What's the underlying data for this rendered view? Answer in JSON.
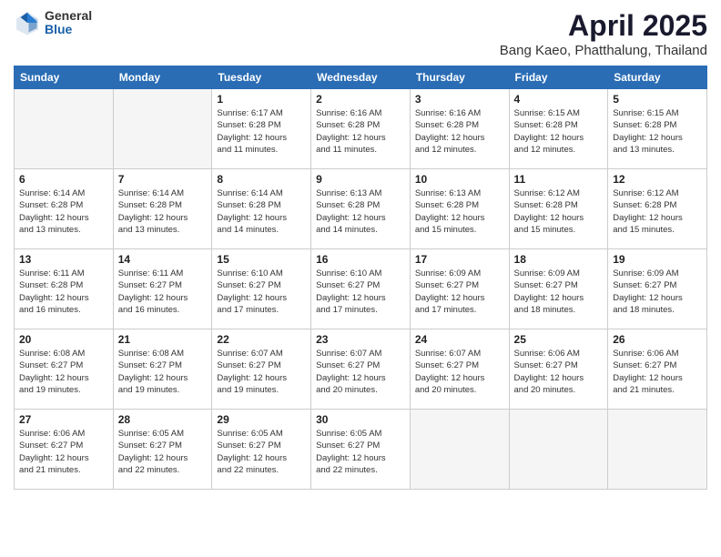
{
  "logo": {
    "general": "General",
    "blue": "Blue"
  },
  "title": "April 2025",
  "subtitle": "Bang Kaeo, Phatthalung, Thailand",
  "headers": [
    "Sunday",
    "Monday",
    "Tuesday",
    "Wednesday",
    "Thursday",
    "Friday",
    "Saturday"
  ],
  "weeks": [
    [
      {
        "day": "",
        "info": ""
      },
      {
        "day": "",
        "info": ""
      },
      {
        "day": "1",
        "info": "Sunrise: 6:17 AM\nSunset: 6:28 PM\nDaylight: 12 hours\nand 11 minutes."
      },
      {
        "day": "2",
        "info": "Sunrise: 6:16 AM\nSunset: 6:28 PM\nDaylight: 12 hours\nand 11 minutes."
      },
      {
        "day": "3",
        "info": "Sunrise: 6:16 AM\nSunset: 6:28 PM\nDaylight: 12 hours\nand 12 minutes."
      },
      {
        "day": "4",
        "info": "Sunrise: 6:15 AM\nSunset: 6:28 PM\nDaylight: 12 hours\nand 12 minutes."
      },
      {
        "day": "5",
        "info": "Sunrise: 6:15 AM\nSunset: 6:28 PM\nDaylight: 12 hours\nand 13 minutes."
      }
    ],
    [
      {
        "day": "6",
        "info": "Sunrise: 6:14 AM\nSunset: 6:28 PM\nDaylight: 12 hours\nand 13 minutes."
      },
      {
        "day": "7",
        "info": "Sunrise: 6:14 AM\nSunset: 6:28 PM\nDaylight: 12 hours\nand 13 minutes."
      },
      {
        "day": "8",
        "info": "Sunrise: 6:14 AM\nSunset: 6:28 PM\nDaylight: 12 hours\nand 14 minutes."
      },
      {
        "day": "9",
        "info": "Sunrise: 6:13 AM\nSunset: 6:28 PM\nDaylight: 12 hours\nand 14 minutes."
      },
      {
        "day": "10",
        "info": "Sunrise: 6:13 AM\nSunset: 6:28 PM\nDaylight: 12 hours\nand 15 minutes."
      },
      {
        "day": "11",
        "info": "Sunrise: 6:12 AM\nSunset: 6:28 PM\nDaylight: 12 hours\nand 15 minutes."
      },
      {
        "day": "12",
        "info": "Sunrise: 6:12 AM\nSunset: 6:28 PM\nDaylight: 12 hours\nand 15 minutes."
      }
    ],
    [
      {
        "day": "13",
        "info": "Sunrise: 6:11 AM\nSunset: 6:28 PM\nDaylight: 12 hours\nand 16 minutes."
      },
      {
        "day": "14",
        "info": "Sunrise: 6:11 AM\nSunset: 6:27 PM\nDaylight: 12 hours\nand 16 minutes."
      },
      {
        "day": "15",
        "info": "Sunrise: 6:10 AM\nSunset: 6:27 PM\nDaylight: 12 hours\nand 17 minutes."
      },
      {
        "day": "16",
        "info": "Sunrise: 6:10 AM\nSunset: 6:27 PM\nDaylight: 12 hours\nand 17 minutes."
      },
      {
        "day": "17",
        "info": "Sunrise: 6:09 AM\nSunset: 6:27 PM\nDaylight: 12 hours\nand 17 minutes."
      },
      {
        "day": "18",
        "info": "Sunrise: 6:09 AM\nSunset: 6:27 PM\nDaylight: 12 hours\nand 18 minutes."
      },
      {
        "day": "19",
        "info": "Sunrise: 6:09 AM\nSunset: 6:27 PM\nDaylight: 12 hours\nand 18 minutes."
      }
    ],
    [
      {
        "day": "20",
        "info": "Sunrise: 6:08 AM\nSunset: 6:27 PM\nDaylight: 12 hours\nand 19 minutes."
      },
      {
        "day": "21",
        "info": "Sunrise: 6:08 AM\nSunset: 6:27 PM\nDaylight: 12 hours\nand 19 minutes."
      },
      {
        "day": "22",
        "info": "Sunrise: 6:07 AM\nSunset: 6:27 PM\nDaylight: 12 hours\nand 19 minutes."
      },
      {
        "day": "23",
        "info": "Sunrise: 6:07 AM\nSunset: 6:27 PM\nDaylight: 12 hours\nand 20 minutes."
      },
      {
        "day": "24",
        "info": "Sunrise: 6:07 AM\nSunset: 6:27 PM\nDaylight: 12 hours\nand 20 minutes."
      },
      {
        "day": "25",
        "info": "Sunrise: 6:06 AM\nSunset: 6:27 PM\nDaylight: 12 hours\nand 20 minutes."
      },
      {
        "day": "26",
        "info": "Sunrise: 6:06 AM\nSunset: 6:27 PM\nDaylight: 12 hours\nand 21 minutes."
      }
    ],
    [
      {
        "day": "27",
        "info": "Sunrise: 6:06 AM\nSunset: 6:27 PM\nDaylight: 12 hours\nand 21 minutes."
      },
      {
        "day": "28",
        "info": "Sunrise: 6:05 AM\nSunset: 6:27 PM\nDaylight: 12 hours\nand 22 minutes."
      },
      {
        "day": "29",
        "info": "Sunrise: 6:05 AM\nSunset: 6:27 PM\nDaylight: 12 hours\nand 22 minutes."
      },
      {
        "day": "30",
        "info": "Sunrise: 6:05 AM\nSunset: 6:27 PM\nDaylight: 12 hours\nand 22 minutes."
      },
      {
        "day": "",
        "info": ""
      },
      {
        "day": "",
        "info": ""
      },
      {
        "day": "",
        "info": ""
      }
    ]
  ]
}
